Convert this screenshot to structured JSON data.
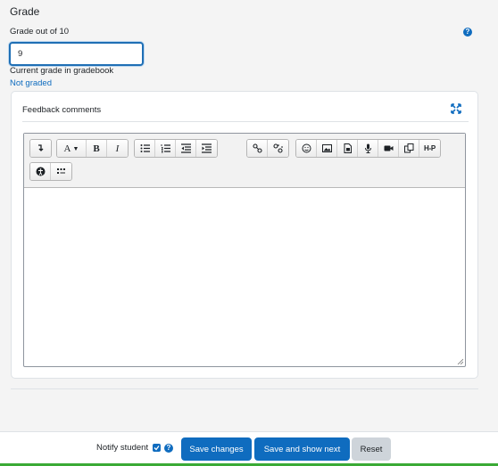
{
  "grade": {
    "heading": "Grade",
    "label": "Grade out of 10",
    "value": "9",
    "current_label": "Current grade in gradebook",
    "current_value": "Not graded"
  },
  "feedback": {
    "title": "Feedback comments",
    "toolbar_row1": [
      {
        "group": [
          "collapse-icon"
        ]
      },
      {
        "group": [
          "font-icon",
          "bold-icon",
          "italic-icon"
        ]
      },
      {
        "group": [
          "unordered-list-icon",
          "ordered-list-icon",
          "outdent-icon",
          "indent-icon"
        ]
      },
      {
        "group": [
          "link-icon",
          "unlink-icon"
        ]
      },
      {
        "group": [
          "emoji-icon",
          "image-icon",
          "media-icon",
          "record-audio-icon",
          "record-video-icon",
          "manage-files-icon",
          "h5p-icon"
        ]
      }
    ],
    "toolbar_row2": [
      {
        "group": [
          "accessibility-checker-icon",
          "screenreader-helper-icon"
        ]
      }
    ],
    "labels": {
      "font": "A",
      "bold": "B",
      "italic": "I",
      "h5p": "H-P"
    }
  },
  "footer": {
    "notify_label": "Notify student",
    "notify_checked": true,
    "save_label": "Save changes",
    "save_next_label": "Save and show next",
    "reset_label": "Reset"
  },
  "colors": {
    "primary": "#0f6cbf",
    "secondary": "#ced4da",
    "brand_bar": "#3aaa35"
  }
}
